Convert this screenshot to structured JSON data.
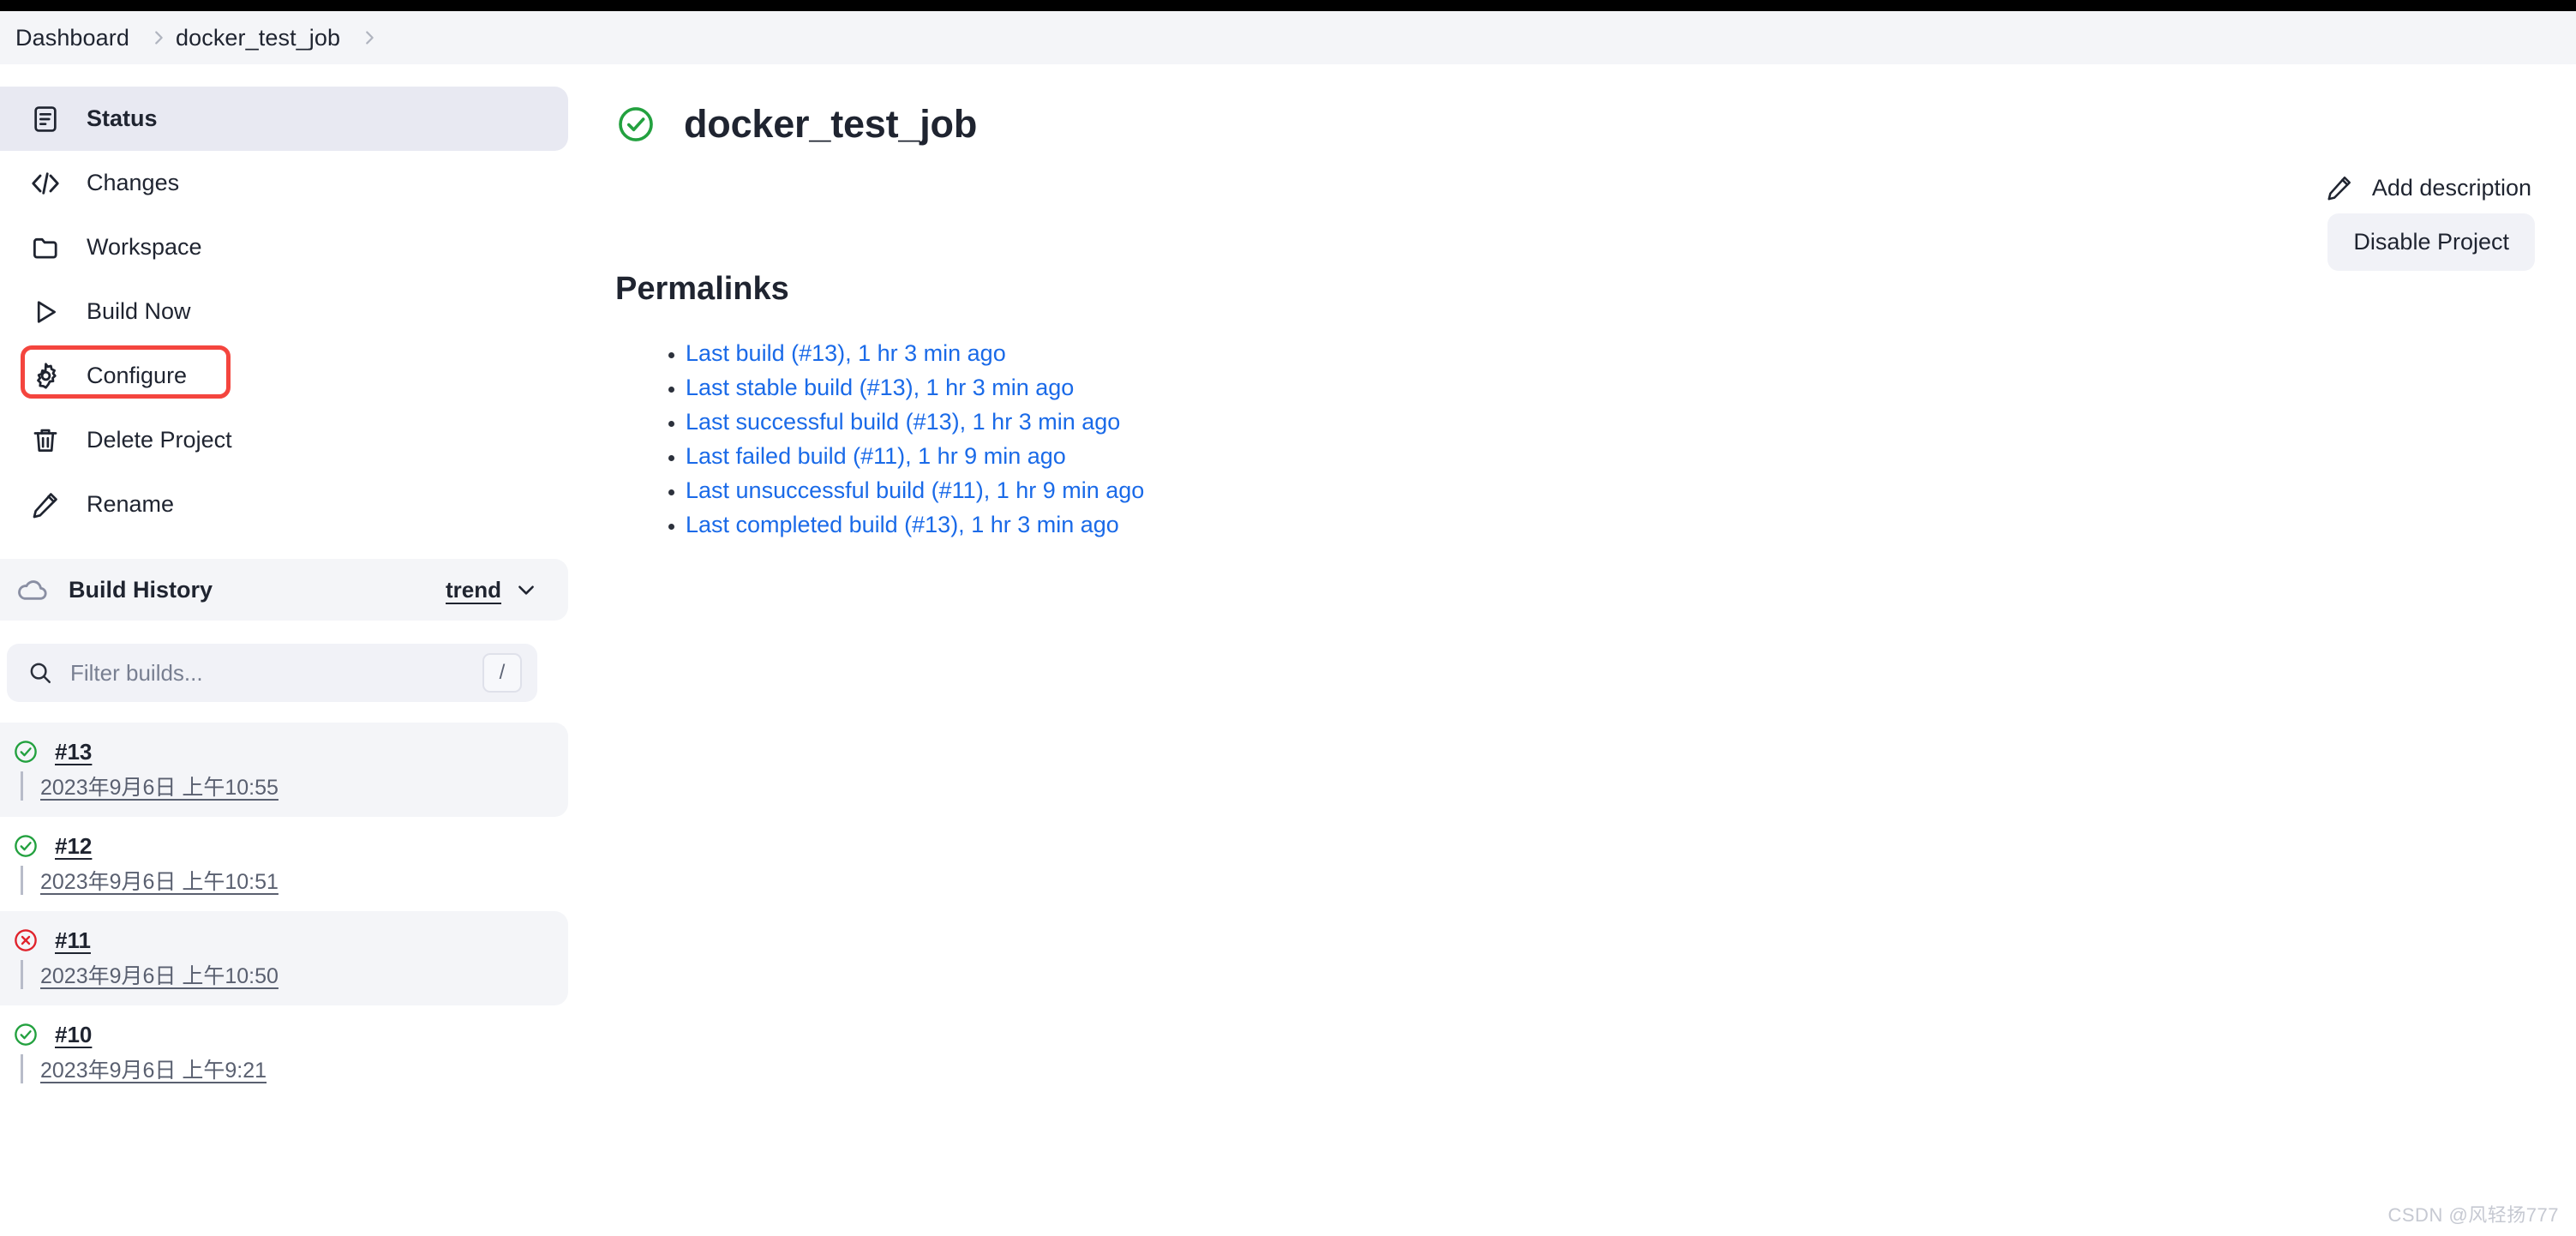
{
  "breadcrumb": {
    "items": [
      {
        "label": "Dashboard"
      },
      {
        "label": "docker_test_job"
      }
    ],
    "separator_icon": "chevron-right-icon"
  },
  "sidebar": {
    "nav_items": [
      {
        "label": "Status",
        "icon": "document-icon",
        "active": true
      },
      {
        "label": "Changes",
        "icon": "code-icon",
        "active": false
      },
      {
        "label": "Workspace",
        "icon": "folder-icon",
        "active": false
      },
      {
        "label": "Build Now",
        "icon": "play-icon",
        "active": false
      },
      {
        "label": "Configure",
        "icon": "gear-icon",
        "active": false,
        "annotated": true
      },
      {
        "label": "Delete Project",
        "icon": "trash-icon",
        "active": false
      },
      {
        "label": "Rename",
        "icon": "pencil-icon",
        "active": false
      }
    ],
    "build_history": {
      "title": "Build History",
      "icon": "cloud-icon",
      "trend_label": "trend",
      "trend_icon": "chevron-down-icon"
    },
    "filter": {
      "placeholder": "Filter builds...",
      "value": "",
      "icon": "search-icon",
      "shortcut": "/"
    },
    "builds": [
      {
        "number": "#13",
        "date": "2023年9月6日 上午10:55",
        "status": "success",
        "shaded": true
      },
      {
        "number": "#12",
        "date": "2023年9月6日 上午10:51",
        "status": "success",
        "shaded": false
      },
      {
        "number": "#11",
        "date": "2023年9月6日 上午10:50",
        "status": "failed",
        "shaded": true
      },
      {
        "number": "#10",
        "date": "2023年9月6日 上午9:21",
        "status": "success",
        "shaded": false
      }
    ]
  },
  "main": {
    "job_title": "docker_test_job",
    "job_status": "success",
    "add_description_label": "Add description",
    "add_description_icon": "pencil-icon",
    "disable_project_label": "Disable Project",
    "permalinks_title": "Permalinks",
    "permalinks": [
      {
        "label": "Last build (#13), 1 hr 3 min ago"
      },
      {
        "label": "Last stable build (#13), 1 hr 3 min ago"
      },
      {
        "label": "Last successful build (#13), 1 hr 3 min ago"
      },
      {
        "label": "Last failed build (#11), 1 hr 9 min ago"
      },
      {
        "label": "Last unsuccessful build (#11), 1 hr 9 min ago"
      },
      {
        "label": "Last completed build (#13), 1 hr 3 min ago"
      }
    ]
  },
  "watermark": "CSDN @风轻扬777",
  "colors": {
    "success": "#23a13f",
    "failure": "#e0232c",
    "link": "#1a6ae8",
    "annotation": "#f4453e",
    "active_nav_bg": "#e8e9f2",
    "panel_bg": "#f4f5f8"
  }
}
